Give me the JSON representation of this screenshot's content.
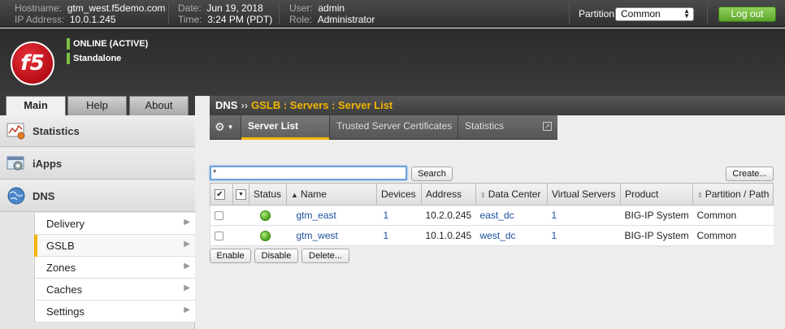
{
  "header": {
    "hostname_label": "Hostname:",
    "hostname": "gtm_west.f5demo.com",
    "ip_label": "IP Address:",
    "ip": "10.0.1.245",
    "date_label": "Date:",
    "date": "Jun 19, 2018",
    "time_label": "Time:",
    "time": "3:24 PM (PDT)",
    "user_label": "User:",
    "user": "admin",
    "role_label": "Role:",
    "role": "Administrator",
    "partition_label": "Partition:",
    "partition_value": "Common",
    "logout": "Log out"
  },
  "status": {
    "logo_text": "f5",
    "online": "ONLINE (ACTIVE)",
    "mode": "Standalone",
    "accent": "#7ac143"
  },
  "left_tabs": [
    {
      "label": "Main"
    },
    {
      "label": "Help"
    },
    {
      "label": "About"
    }
  ],
  "sidebar": {
    "sections": [
      {
        "label": "Statistics",
        "icon": "statistics-chart-icon"
      },
      {
        "label": "iApps",
        "icon": "iapps-icon"
      },
      {
        "label": "DNS",
        "icon": "globe-icon"
      }
    ],
    "dns_items": [
      {
        "label": "Delivery"
      },
      {
        "label": "GSLB"
      },
      {
        "label": "Zones"
      },
      {
        "label": "Caches"
      },
      {
        "label": "Settings"
      }
    ]
  },
  "breadcrumb": {
    "root": "DNS",
    "separator": "››",
    "path": "GSLB : Servers : Server List"
  },
  "subtabs": [
    {
      "label": "Server List"
    },
    {
      "label": "Trusted Server Certificates"
    },
    {
      "label": "Statistics"
    }
  ],
  "toolbar": {
    "search_value": "*",
    "search_button": "Search",
    "create_button": "Create..."
  },
  "table": {
    "columns": [
      "Status",
      "Name",
      "Devices",
      "Address",
      "Data Center",
      "Virtual Servers",
      "Product",
      "Partition / Path"
    ],
    "rows": [
      {
        "name": "gtm_east",
        "devices": "1",
        "address": "10.2.0.245",
        "data_center": "east_dc",
        "virtual_servers": "1",
        "product": "BIG-IP System",
        "partition": "Common"
      },
      {
        "name": "gtm_west",
        "devices": "1",
        "address": "10.1.0.245",
        "data_center": "west_dc",
        "virtual_servers": "1",
        "product": "BIG-IP System",
        "partition": "Common"
      }
    ]
  },
  "actions": {
    "enable": "Enable",
    "disable": "Disable",
    "delete": "Delete..."
  }
}
